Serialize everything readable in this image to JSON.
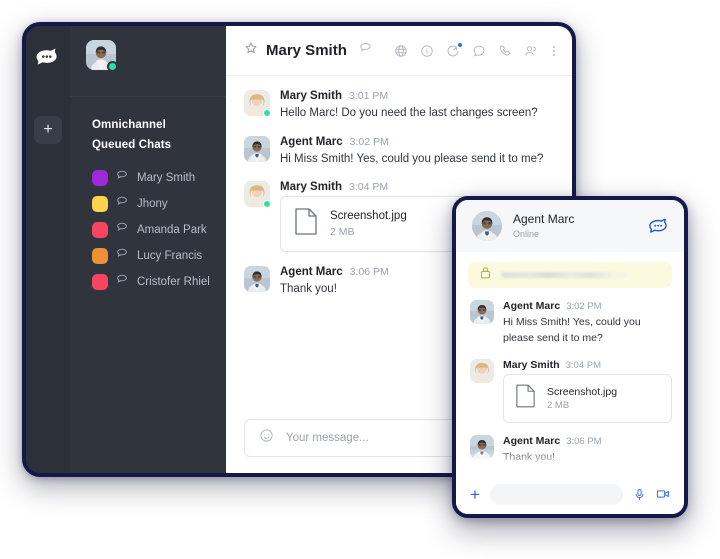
{
  "app": {
    "logo_icon": "rocketchat-logo-icon",
    "add_button_label": "+",
    "add_button_icon": "plus-icon"
  },
  "sidebar": {
    "avatar_icon": "user-avatar",
    "presence": "online",
    "section_title": "Omnichannel Queued Chats",
    "chats": [
      {
        "name": "Mary Smith",
        "color": "#9e29da",
        "icon": "balloon-icon"
      },
      {
        "name": "Jhony",
        "color": "#fbd34d",
        "icon": "balloon-icon"
      },
      {
        "name": "Amanda Park",
        "color": "#f8455f",
        "icon": "balloon-icon"
      },
      {
        "name": "Lucy Francis",
        "color": "#ef8e38",
        "icon": "balloon-icon"
      },
      {
        "name": "Cristofer Rhiel",
        "color": "#f8455f",
        "icon": "balloon-icon"
      }
    ]
  },
  "chat_header": {
    "favorite_icon": "star-icon",
    "title": "Mary Smith",
    "type_icon": "balloon-icon",
    "actions": [
      {
        "name": "globe-icon"
      },
      {
        "name": "info-circle-icon"
      },
      {
        "name": "threads-icon",
        "badge": true
      },
      {
        "name": "discussion-icon"
      },
      {
        "name": "phone-icon"
      },
      {
        "name": "team-icon"
      },
      {
        "name": "kebab-menu-icon"
      }
    ]
  },
  "messages": [
    {
      "author": "Mary Smith",
      "time": "3:01 PM",
      "text": "Hello Marc! Do you need the last changes screen?",
      "avatar": "mary-avatar",
      "presence": "online"
    },
    {
      "author": "Agent Marc",
      "time": "3:02 PM",
      "text": "Hi Miss Smith! Yes, could you please send it to me?",
      "avatar": "marc-avatar",
      "presence": "none"
    },
    {
      "author": "Mary Smith",
      "time": "3:04 PM",
      "avatar": "mary-avatar",
      "presence": "online",
      "attachment": {
        "name": "Screenshot.jpg",
        "size": "2 MB",
        "icon": "file-icon"
      }
    },
    {
      "author": "Agent Marc",
      "time": "3:06 PM",
      "text": "Thank you!",
      "avatar": "marc-avatar",
      "presence": "none"
    }
  ],
  "composer": {
    "emoji_icon": "emoji-smiley-icon",
    "placeholder": "Your message..."
  },
  "mobile_widget": {
    "header": {
      "avatar": "marc-avatar",
      "name": "Agent Marc",
      "status": "Online",
      "logo_icon": "rocketchat-balloon-icon"
    },
    "notice": {
      "icon": "lock-icon",
      "text": ""
    },
    "messages": [
      {
        "author": "Agent Marc",
        "time": "3:02 PM",
        "text": "Hi Miss Smith! Yes, could you please send it to me?",
        "avatar": "marc-avatar"
      },
      {
        "author": "Mary Smith",
        "time": "3:04 PM",
        "avatar": "mary-avatar",
        "attachment": {
          "name": "Screenshot.jpg",
          "size": "2 MB",
          "icon": "file-icon"
        }
      },
      {
        "author": "Agent Marc",
        "time": "3:06 PM",
        "text": "Thank you!",
        "avatar": "marc-avatar"
      }
    ],
    "composer": {
      "plus_label": "+",
      "input_value": "",
      "mic_icon": "microphone-icon",
      "camera_icon": "video-camera-icon"
    }
  },
  "colors": {
    "window_border": "#15184a",
    "sidebar_bg": "#2f343d",
    "rail_bg": "#2b3039",
    "accent_blue": "#1d74f5",
    "presence_green": "#2de0a5",
    "notice_yellow": "#fbfadf"
  }
}
